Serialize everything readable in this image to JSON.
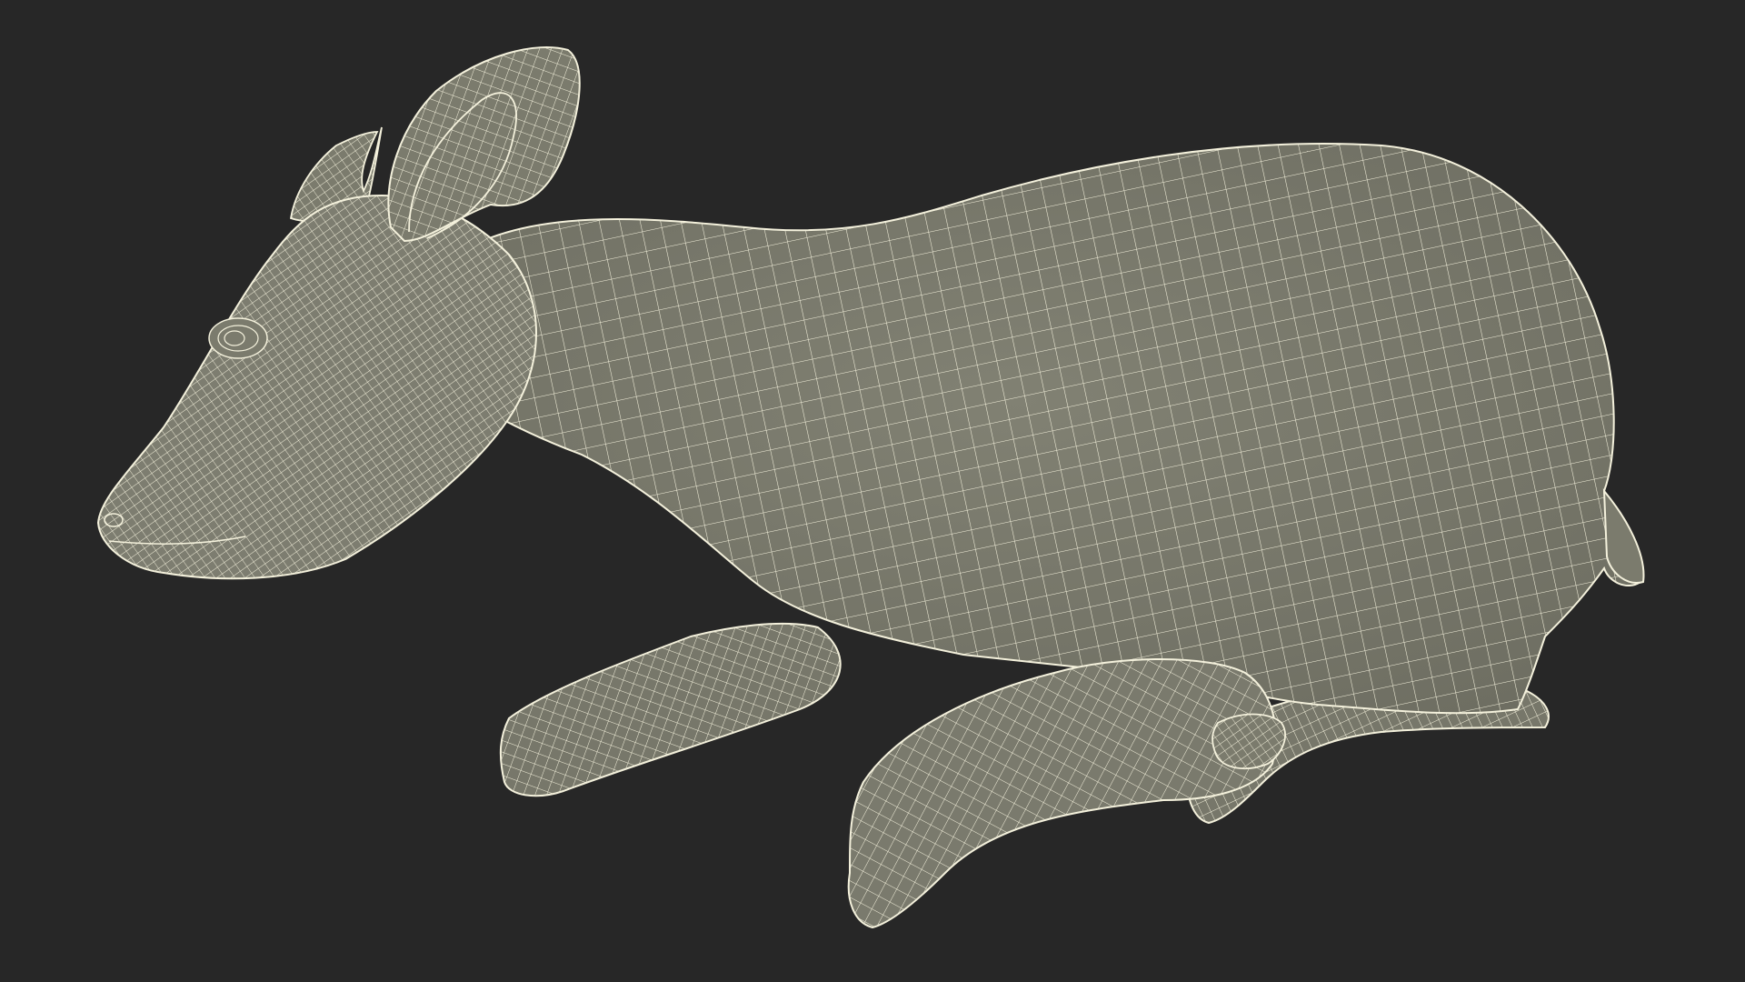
{
  "scene": {
    "background_color": "#272727",
    "model_fill_color": "#7b7b6d",
    "model_shade_color": "#6a6a5e",
    "wire_color": "#f4f1dc",
    "subject": "deer-fawn-lying-wireframe-icon",
    "render_style": "wireframe-on-shaded"
  }
}
